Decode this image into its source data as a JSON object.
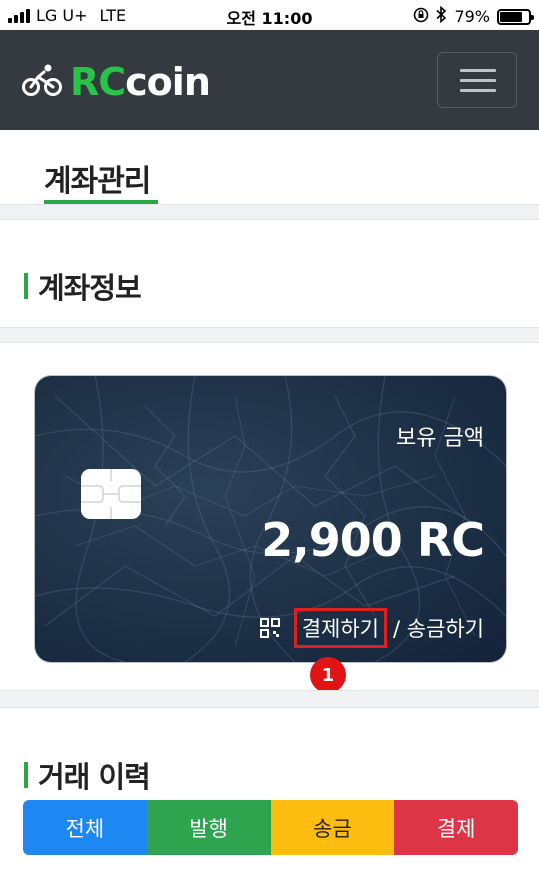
{
  "status_bar": {
    "carrier": "LG U+",
    "network": "LTE",
    "time": "오전 11:00",
    "battery": "79%",
    "battery_level": 0.79
  },
  "navbar": {
    "brand_rc": "RC",
    "brand_coin": "coin",
    "brand_icon": "bicycle-icon",
    "menu_icon": "hamburger-icon"
  },
  "tabs": {
    "active": "계좌관리",
    "accent_color": "#28a745"
  },
  "account": {
    "section_title": "계좌정보",
    "card": {
      "label": "보유 금액",
      "balance": "2,900 RC",
      "pay": "결제하기",
      "transfer": "/ 송금하기",
      "qr_icon": "qr-code-icon"
    },
    "annotation_marker": "1"
  },
  "history": {
    "section_title": "거래 이력",
    "filters": [
      {
        "label": "전체",
        "color": "#1e88f2"
      },
      {
        "label": "발행",
        "color": "#2ea44f"
      },
      {
        "label": "송금",
        "color": "#fdbd10"
      },
      {
        "label": "결제",
        "color": "#dc3545"
      }
    ]
  }
}
